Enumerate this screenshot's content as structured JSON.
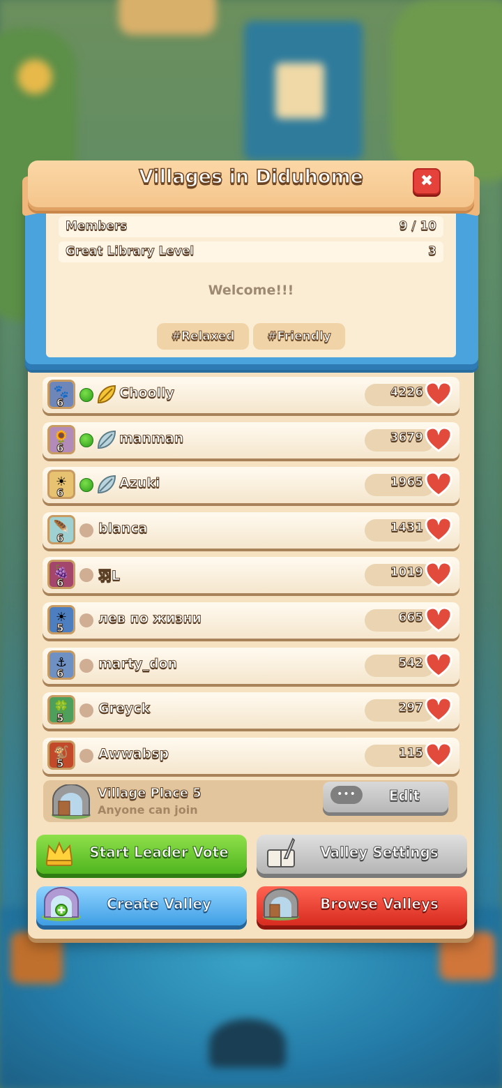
{
  "dialog": {
    "title": "Villages in Diduhome",
    "close_glyph": "✖"
  },
  "info": {
    "members_label": "Members",
    "members_value": "9 / 10",
    "library_label": "Great Library Level",
    "library_value": "3",
    "welcome": "Welcome!!!",
    "tags": [
      "#Relaxed",
      "#Friendly"
    ]
  },
  "members": [
    {
      "name": "Choolly",
      "score": "4226",
      "level": "6",
      "online": true,
      "rank": "gold-leaf-icon",
      "avatar_glyph": "🐾"
    },
    {
      "name": "manman",
      "score": "3679",
      "level": "6",
      "online": true,
      "rank": "silver-leaf-icon",
      "avatar_glyph": "🌻"
    },
    {
      "name": "Azuki",
      "score": "1965",
      "level": "6",
      "online": true,
      "rank": "silver-leaf-icon",
      "avatar_glyph": "☀"
    },
    {
      "name": "blanca",
      "score": "1431",
      "level": "6",
      "online": false,
      "rank": "",
      "avatar_glyph": "🪶"
    },
    {
      "name": "羽L",
      "score": "1019",
      "level": "6",
      "online": false,
      "rank": "",
      "avatar_glyph": "🍇"
    },
    {
      "name": "лев по жизни",
      "score": "665",
      "level": "5",
      "online": false,
      "rank": "",
      "avatar_glyph": "☀"
    },
    {
      "name": "marty_don",
      "score": "542",
      "level": "6",
      "online": false,
      "rank": "",
      "avatar_glyph": "⚓"
    },
    {
      "name": "Greyck",
      "score": "297",
      "level": "5",
      "online": false,
      "rank": "",
      "avatar_glyph": "🍀"
    },
    {
      "name": "Awwabsp",
      "score": "115",
      "level": "5",
      "online": false,
      "rank": "",
      "avatar_glyph": "🐒"
    }
  ],
  "place": {
    "title": "Village Place 5",
    "subtitle": "Anyone can join",
    "edit_dots": "•••",
    "edit_label": "Edit"
  },
  "buttons": {
    "leader_vote": "Start Leader Vote",
    "valley_settings": "Valley Settings",
    "create_valley": "Create Valley",
    "browse_valleys": "Browse Valleys"
  },
  "colors": {
    "panel": "#f6e1c0",
    "frame_blue": "#4aa3dc",
    "online_green": "#2c9b1b",
    "heart_red": "#e24b3b"
  }
}
